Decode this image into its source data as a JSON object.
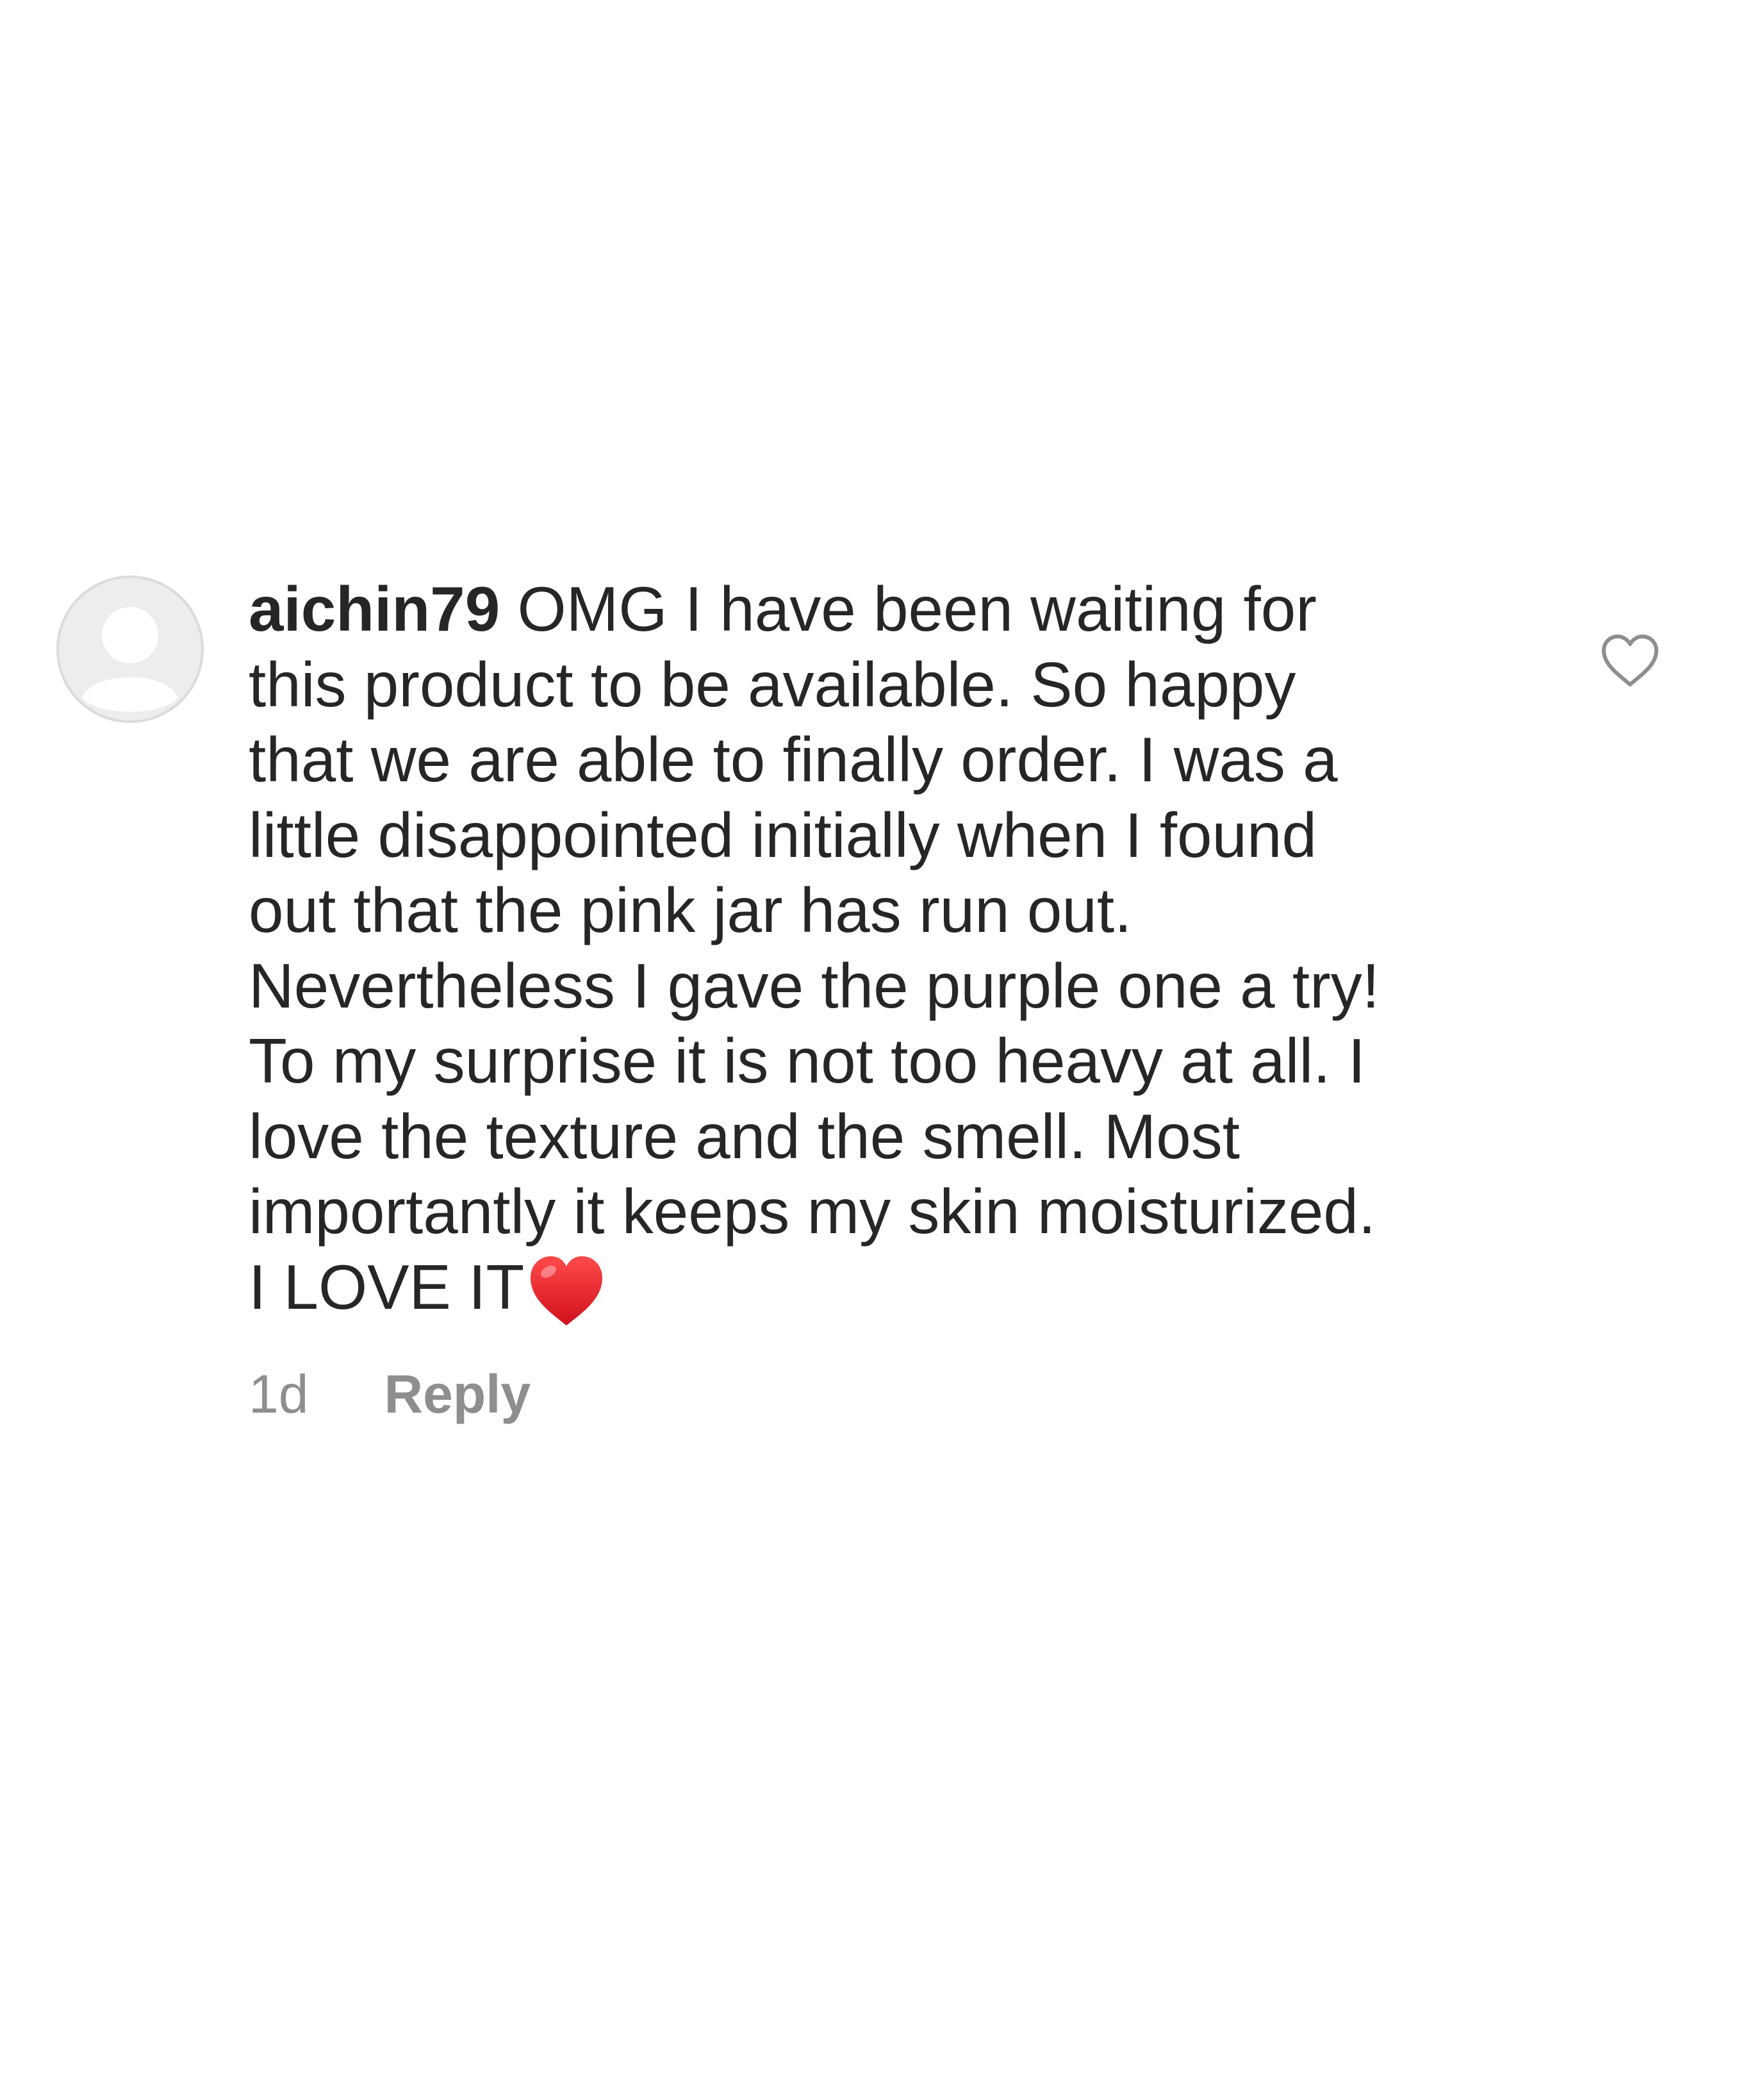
{
  "comment": {
    "username": "aichin79",
    "lines": [
      "OMG I have been waiting for",
      "this product to be available. So happy",
      "that we are able to finally order. I was a",
      "little disappointed initially when I found",
      "out that the pink jar has run out.",
      "Nevertheless I gave the purple one a try!",
      "To my surprise it is not too heavy at all. I",
      "love the texture and the smell. Most",
      "importantly it keeps my skin moisturized.",
      "I LOVE IT"
    ],
    "emoji": "red-heart-emoji",
    "timestamp": "1d",
    "reply_label": "Reply",
    "liked": false
  },
  "colors": {
    "text": "#262626",
    "meta": "#8e8e8e",
    "avatar_bg": "#dbdbdb",
    "heart_red": "#e0242f"
  }
}
